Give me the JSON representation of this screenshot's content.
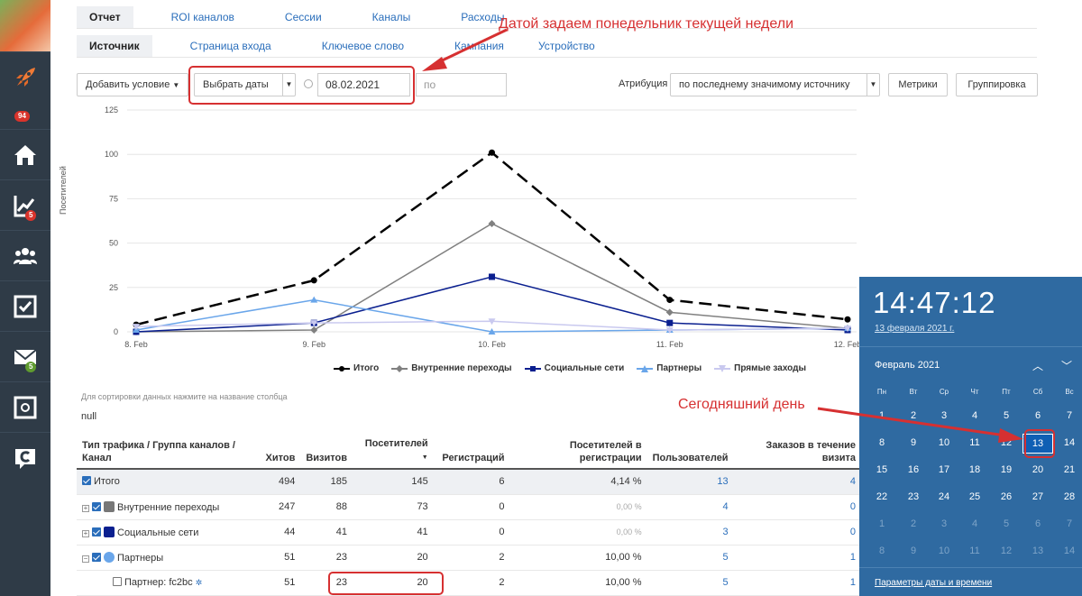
{
  "sidebar": {
    "badges": [
      "94",
      "5",
      "5"
    ],
    "icons": [
      "rocket-icon",
      "home-icon",
      "trend-chart-icon",
      "users-icon",
      "checkbox-icon",
      "mail-icon",
      "safe-icon",
      "c-logo-icon"
    ]
  },
  "tabs_row1": [
    "Отчет",
    "ROI каналов",
    "Сессии",
    "Каналы",
    "Расходы"
  ],
  "tabs_row2": [
    "Источник",
    "Страница входа",
    "Ключевое слово",
    "Кампания",
    "Устройство"
  ],
  "filters": {
    "add_condition": "Добавить условие",
    "date_select": "Выбрать даты",
    "date_from": "08.02.2021",
    "date_to_placeholder": "по",
    "attribution_label": "Атрибуция",
    "attribution_value": "по последнему значимому источнику",
    "metrics_button": "Метрики",
    "grouping_button": "Группировка"
  },
  "annotations": {
    "top": "Датой задаем понедельник текущей недели",
    "today": "Сегодняшний день"
  },
  "colors": {
    "accent": "#2a6ebb",
    "annotation": "#d63031",
    "calendar_bg": "#2f6aa1"
  },
  "chart_data": {
    "type": "line",
    "ylabel": "Посетителей",
    "ylim": [
      0,
      125
    ],
    "yticks": [
      "0",
      "25",
      "50",
      "75",
      "100",
      "125"
    ],
    "categories": [
      "8. Feb",
      "9. Feb",
      "10. Feb",
      "11. Feb",
      "12. Feb"
    ],
    "series": [
      {
        "name": "Итого",
        "color": "#000000",
        "dash": true,
        "marker": "circle",
        "values": [
          4,
          29,
          101,
          18,
          7
        ]
      },
      {
        "name": "Внутренние переходы",
        "color": "#808080",
        "dash": false,
        "marker": "diamond",
        "values": [
          0,
          1,
          61,
          11,
          2
        ]
      },
      {
        "name": "Социальные сети",
        "color": "#0a1f8f",
        "dash": false,
        "marker": "square",
        "values": [
          0,
          5,
          31,
          5,
          1
        ]
      },
      {
        "name": "Партнеры",
        "color": "#6aa6ea",
        "dash": false,
        "marker": "triangle",
        "values": [
          1,
          18,
          0,
          1,
          2
        ]
      },
      {
        "name": "Прямые заходы",
        "color": "#c9c9ef",
        "dash": false,
        "marker": "triangle-down",
        "values": [
          3,
          5,
          6,
          1,
          2
        ]
      }
    ]
  },
  "table": {
    "hint": "Для сортировки данных нажмите на название столбца",
    "null_text": "null",
    "headers": [
      "Тип трафика / Группа каналов / Канал",
      "Хитов",
      "Визитов",
      "Посетителей",
      "Регистраций",
      "Посетителей в регистрации",
      "Пользователей",
      "Заказов в течение визита"
    ],
    "rows": [
      {
        "label": "Итого",
        "cells": [
          "494",
          "185",
          "145",
          "6",
          "4,14 %",
          "13",
          "4"
        ]
      },
      {
        "label": "Внутренние переходы",
        "cells": [
          "247",
          "88",
          "73",
          "0",
          "0,00 %",
          "4",
          "0"
        ]
      },
      {
        "label": "Социальные сети",
        "cells": [
          "44",
          "41",
          "41",
          "0",
          "0,00 %",
          "3",
          "0"
        ]
      },
      {
        "label": "Партнеры",
        "cells": [
          "51",
          "23",
          "20",
          "2",
          "10,00 %",
          "5",
          "1"
        ]
      },
      {
        "label": "Партнер: fc2bc",
        "cells": [
          "51",
          "23",
          "20",
          "2",
          "10,00 %",
          "5",
          "1"
        ]
      }
    ]
  },
  "calendar": {
    "time": "14:47:12",
    "date": "13 февраля 2021 г.",
    "month": "Февраль 2021",
    "dow": [
      "Пн",
      "Вт",
      "Ср",
      "Чт",
      "Пт",
      "Сб",
      "Вс"
    ],
    "weeks": [
      [
        "1",
        "2",
        "3",
        "4",
        "5",
        "6",
        "7"
      ],
      [
        "8",
        "9",
        "10",
        "11",
        "12",
        "13",
        "14"
      ],
      [
        "15",
        "16",
        "17",
        "18",
        "19",
        "20",
        "21"
      ],
      [
        "22",
        "23",
        "24",
        "25",
        "26",
        "27",
        "28"
      ],
      [
        "1",
        "2",
        "3",
        "4",
        "5",
        "6",
        "7"
      ],
      [
        "8",
        "9",
        "10",
        "11",
        "12",
        "13",
        "14"
      ]
    ],
    "today": "13",
    "settings_link": "Параметры даты и времени"
  }
}
